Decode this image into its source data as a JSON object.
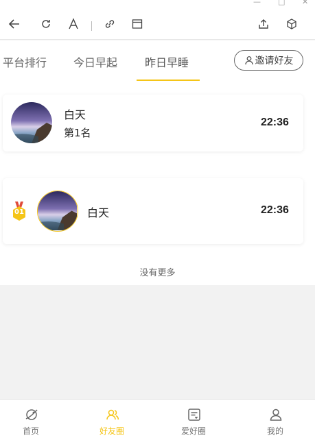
{
  "window": {
    "controls": [
      "—",
      "□",
      "✕"
    ]
  },
  "toolbar": {
    "icons": [
      "back-arrow-icon",
      "refresh-icon",
      "font-size-icon",
      "link-icon",
      "window-icon",
      "share-icon",
      "cube-icon"
    ]
  },
  "tabs": [
    {
      "label": "平台排行",
      "active": false
    },
    {
      "label": "今日早起",
      "active": false
    },
    {
      "label": "昨日早睡",
      "active": true
    }
  ],
  "invite_button": {
    "label": "邀请好友"
  },
  "my_card": {
    "name": "白天",
    "rank": "第1名",
    "time": "22:36"
  },
  "ranking_list": [
    {
      "badge": "01",
      "name": "白天",
      "time": "22:36"
    }
  ],
  "no_more": "没有更多",
  "bottom_nav": [
    {
      "label": "首页",
      "icon": "planet-icon",
      "active": false
    },
    {
      "label": "好友圈",
      "icon": "friends-icon",
      "active": true
    },
    {
      "label": "爱好圈",
      "icon": "hobby-list-icon",
      "active": false
    },
    {
      "label": "我的",
      "icon": "person-icon",
      "active": false
    }
  ],
  "colors": {
    "accent": "#f5c518",
    "badge": "#f5c518",
    "ribbon": "#e04b3a"
  }
}
